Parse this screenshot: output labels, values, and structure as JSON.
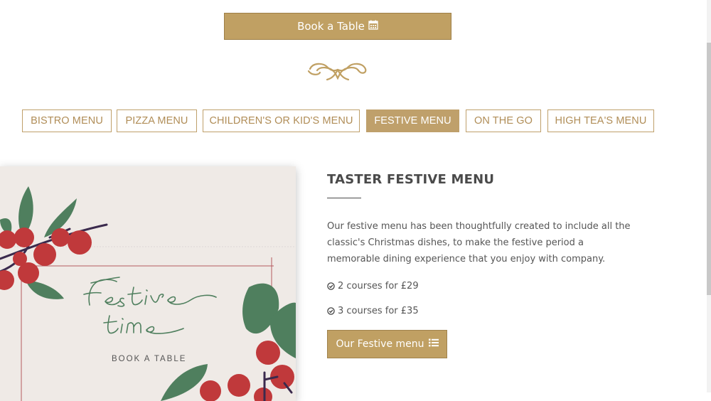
{
  "header": {
    "book_label": "Book a Table",
    "book_icon": "calendar-icon",
    "divider_icon": "flourish-ornament-icon"
  },
  "tabs": [
    {
      "label": "BISTRO MENU",
      "active": false
    },
    {
      "label": "PIZZA MENU",
      "active": false
    },
    {
      "label": "CHILDREN'S OR KID'S MENU",
      "active": false
    },
    {
      "label": "FESTIVE MENU",
      "active": true
    },
    {
      "label": "ON THE GO",
      "active": false
    },
    {
      "label": "HIGH TEA'S MENU",
      "active": false
    }
  ],
  "card": {
    "script_line1": "Festive",
    "script_line2": "time",
    "cta": "BOOK A TABLE"
  },
  "menu": {
    "title": "TASTER FESTIVE MENU",
    "description": "Our festive menu has been thoughtfully created to include all the classic's Christmas dishes, to make the festive period a memorable dining experience that you enjoy with company.",
    "prices": [
      "2 courses for £29",
      "3 courses for £35"
    ],
    "price_icon": "check-circle-icon",
    "button_label": "Our Festive menu",
    "button_icon": "list-icon"
  },
  "colors": {
    "accent": "#c0a063",
    "tab_border": "#bfa06b",
    "berry": "#c0393b",
    "leaf": "#4f7f5e"
  }
}
